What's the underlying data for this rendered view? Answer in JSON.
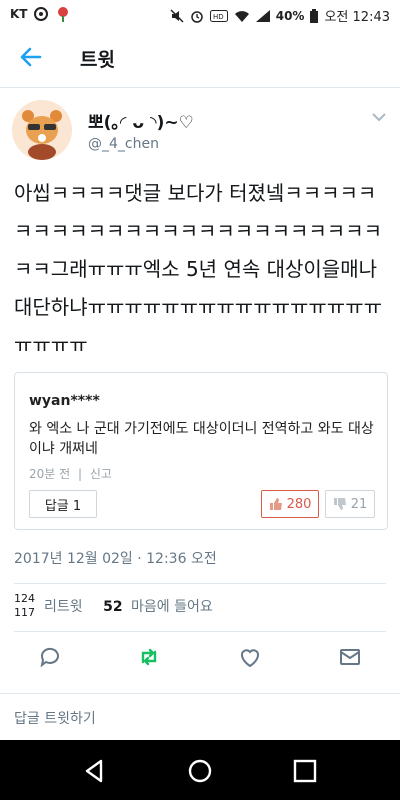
{
  "status_bar": {
    "carrier": "KT",
    "battery": "40%",
    "time": "오전 12:43"
  },
  "header": {
    "title": "트윗"
  },
  "tweet": {
    "display_name": "뽀(｡◜ ᴗ ◝)~♡",
    "handle": "@_4_chen",
    "text": "아씹ㅋㅋㅋㅋ댓글 보다가 터졌넼ㅋㅋㅋㅋㅋㅋㅋㅋㅋㅋㅋㅋㅋㅋㅋㅋㅋㅋㅋㅋㅋㅋㅋㅋㅋㅋㅋ그래ㅠㅠㅠ엑소 5년 연속 대상이을매나 대단하냐ㅠㅠㅠㅠㅠㅠㅠㅠㅠㅠㅠㅠㅠㅠㅠㅠㅠㅠㅠㅠ",
    "timestamp": "2017년 12월 02일 · 12:36 오전",
    "retweets_label": "리트윗",
    "likes_count": "52",
    "likes_label": "마음에 들어요"
  },
  "quote": {
    "user": "wyan****",
    "text": "와 엑소 나 군대 가기전에도 대상이더니 전역하고 와도 대상이냐 개쩌네",
    "time_ago": "20분 전",
    "separator": "|",
    "report": "신고",
    "reply_button": "답글 1",
    "like_count": "280",
    "dislike_count": "21"
  },
  "reply_bar": {
    "placeholder": "답글 트윗하기"
  },
  "colors": {
    "accent": "#1da1f2",
    "retweet_green": "#17bf63",
    "like_red": "#d75a4a"
  }
}
